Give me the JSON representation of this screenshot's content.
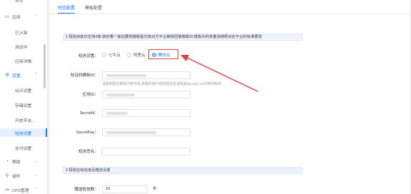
{
  "sidebar": {
    "top_partial": "审核",
    "groups": {
      "apps": {
        "label": "应用",
        "chevron": "⌃"
      },
      "settings": {
        "label": "设置",
        "chevron": "⌃"
      },
      "help": {
        "label": "帮助",
        "chevron": "⌄"
      },
      "plugins": {
        "label": "插件",
        "chevron": "⌄"
      },
      "cps": {
        "label": "CPS管理",
        "chevron": "⌃"
      }
    },
    "app_items": [
      "已上架",
      "测试中",
      "应用详情"
    ],
    "settings_items": [
      "站点设置",
      "存储设置",
      "开放平台...",
      "短信设置",
      "支付设置"
    ],
    "active_item": "短信设置"
  },
  "tabs": [
    {
      "label": "短信配置",
      "active": true
    },
    {
      "label": "模板配置",
      "active": false
    }
  ],
  "notice1": "1.短信目前仅支持3家,绑定哪一家后要将模板提交到对方平台审核回填模板ID;模板中的变量请按照对应平台的标准更改",
  "form": {
    "sms_setting_label": "短信设置：",
    "providers": [
      {
        "label": "七牛云",
        "selected": false
      },
      {
        "label": "阿里云",
        "selected": false
      },
      {
        "label": "腾讯云",
        "selected": true
      }
    ],
    "template_id_label": "验证码模板ID：",
    "template_hint": "请复制短信模板内容中请,单数的用户您的短信验证码是${code},10分钟内有效!",
    "app_id_label": "应用ID：",
    "secret_id_label": "SecretId：",
    "secret_key_label": "SecretKey：",
    "sms_sign_label": "短信签名："
  },
  "notice2": "2.短信在线充值及赠送设置",
  "gift": {
    "label": "赠送短信数：",
    "value": "10",
    "unit": "条"
  },
  "colors": {
    "accent": "#1677ff",
    "annotation": "#e63b3b"
  }
}
